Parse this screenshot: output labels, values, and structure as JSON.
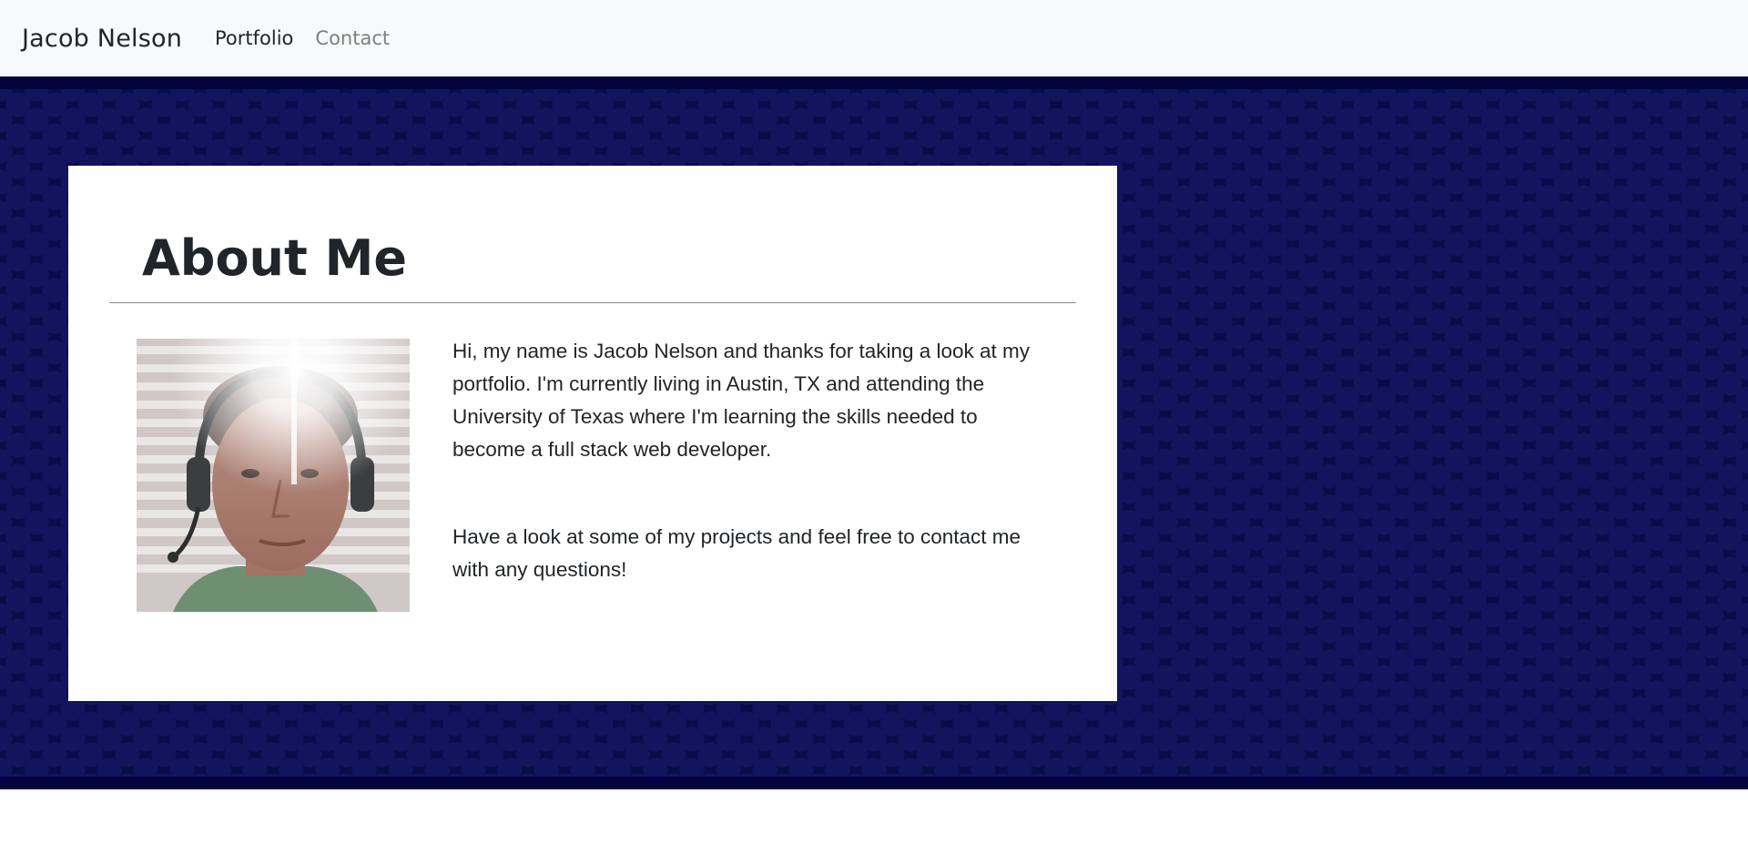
{
  "navbar": {
    "brand": "Jacob Nelson",
    "links": [
      {
        "label": "Portfolio"
      },
      {
        "label": "Contact"
      }
    ]
  },
  "about": {
    "title": "About Me",
    "paragraphs": [
      "Hi, my name is Jacob Nelson and thanks for taking a look at my portfolio. I'm currently living in Austin, TX and attending the University of Texas where I'm learning the skills needed to become a full stack web developer.",
      "Have a look at some of my projects and feel free to contact me with any questions!"
    ]
  },
  "colors": {
    "navbar_bg": "#f8f9fa",
    "hero_bg": "#0a0b4a",
    "card_bg": "#ffffff",
    "text": "#212529",
    "muted_link": "#7f7f7f"
  }
}
